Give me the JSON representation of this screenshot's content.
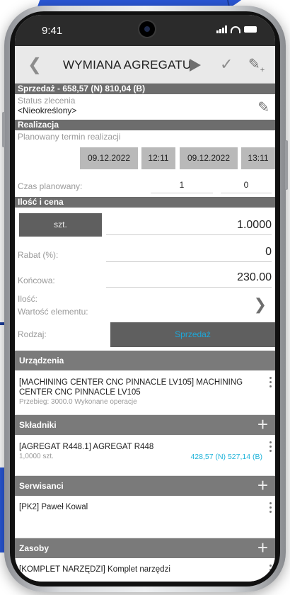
{
  "status_bar": {
    "time": "9:41"
  },
  "header": {
    "back_icon": "chevron-left-icon",
    "title": "WYMIANA AGREGATU",
    "play_icon": "play-icon",
    "check_icon": "check-icon",
    "edit_add_icon": "edit-plus-icon"
  },
  "summary": {
    "text": "Sprzedaż - 658,57 (N) 810,04 (B)"
  },
  "status": {
    "label": "Status zlecenia",
    "value": "<Nieokreślony>"
  },
  "realizacja": {
    "section": "Realizacja",
    "planned_label": "Planowany termin realizacji",
    "start_date": "09.12.2022",
    "start_time": "12:11",
    "end_date": "09.12.2022",
    "end_time": "13:11",
    "duration_label": "Czas planowany:",
    "duration_hours": "1",
    "duration_minutes": "0"
  },
  "ilosc_cena": {
    "section": "Ilość i cena",
    "unit": "szt.",
    "quantity": "1.0000",
    "discount_label": "Rabat (%):",
    "discount": "0",
    "final_label": "Końcowa:",
    "final_value": "230.00",
    "qty_label": "Ilość:",
    "element_value_label": "Wartość elementu:",
    "type_label": "Rodzaj:",
    "type_value": "Sprzedaż"
  },
  "urzadzenia": {
    "section": "Urządzenia",
    "items": [
      {
        "title": "[MACHINING CENTER CNC PINNACLE LV105] MACHINING CENTER CNC PINNACLE LV105",
        "subtitle": "Przebieg: 3000.0 Wykonane operacje"
      }
    ]
  },
  "skladniki": {
    "section": "Składniki",
    "items": [
      {
        "title": "[AGREGAT R448.1] AGREGAT R448",
        "subtitle": "1,0000 szt.",
        "amount": "428,57 (N)  527,14 (B)"
      }
    ]
  },
  "serwisanci": {
    "section": "Serwisanci",
    "items": [
      {
        "title": "[PK2] Paweł Kowal"
      }
    ]
  },
  "zasoby": {
    "section": "Zasoby",
    "items": [
      {
        "title": "[KOMPLET NARZĘDZI] Komplet narzędzi"
      }
    ]
  },
  "colors": {
    "accent": "#1da7d9",
    "section_bg": "#7a7a7a",
    "brand_blue": "#2a58d8"
  }
}
